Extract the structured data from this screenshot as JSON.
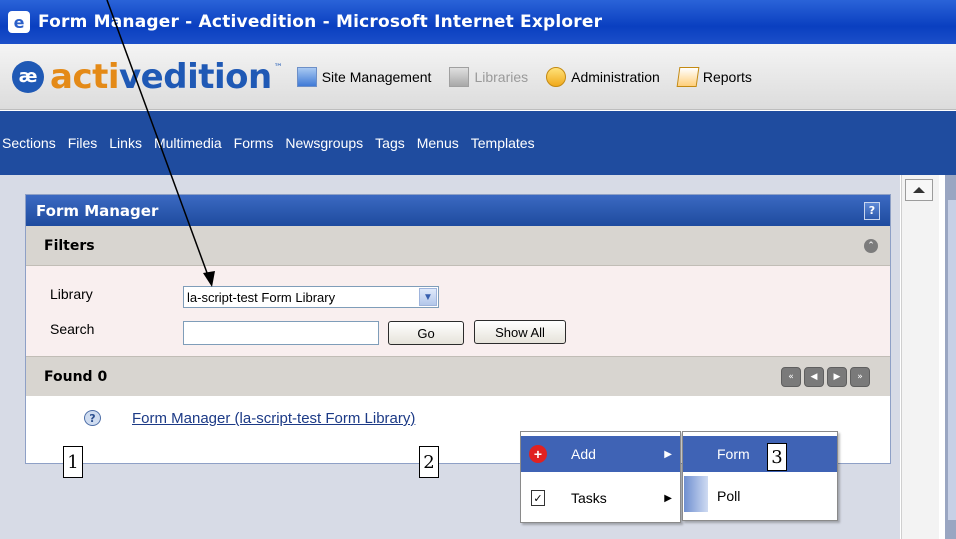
{
  "window": {
    "title": "Form Manager - Activedition - Microsoft Internet Explorer"
  },
  "header": {
    "logo": {
      "part1": "acti",
      "part2": "vedition"
    },
    "tools": [
      {
        "label": "Site Management",
        "icon": "site-management-icon",
        "enabled": true
      },
      {
        "label": "Libraries",
        "icon": "libraries-icon",
        "enabled": false
      },
      {
        "label": "Administration",
        "icon": "administration-icon",
        "enabled": true
      },
      {
        "label": "Reports",
        "icon": "reports-icon",
        "enabled": true
      }
    ]
  },
  "nav": {
    "items": [
      "Sections",
      "Files",
      "Links",
      "Multimedia",
      "Forms",
      "Newsgroups",
      "Tags",
      "Menus",
      "Templates"
    ]
  },
  "panel": {
    "title": "Form Manager",
    "help_icon": "?",
    "filters": {
      "title": "Filters",
      "library_label": "Library",
      "library_value": "la-script-test Form Library",
      "search_label": "Search",
      "search_value": "",
      "go_label": "Go",
      "showall_label": "Show All"
    },
    "found_label": "Found 0",
    "result_link": "Form Manager (la-script-test Form Library)"
  },
  "context_menu": {
    "items": [
      {
        "label": "Add",
        "icon": "plus-icon",
        "has_submenu": true,
        "highlighted": true
      },
      {
        "label": "Tasks",
        "icon": "tasks-icon",
        "has_submenu": true,
        "highlighted": false
      }
    ],
    "submenu": [
      {
        "label": "Form",
        "highlighted": true
      },
      {
        "label": "Poll",
        "highlighted": false
      }
    ]
  },
  "annotations": {
    "labels": [
      "1",
      "2",
      "3"
    ]
  },
  "colors": {
    "nav_bg": "#1f4c9f",
    "panel_head": "#2c59ad",
    "highlight": "#3f63b5"
  }
}
